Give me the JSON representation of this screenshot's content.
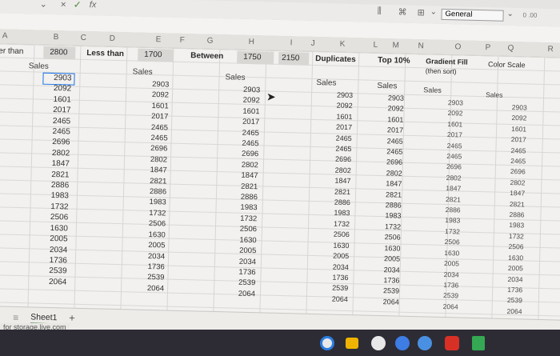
{
  "formula_bar": {
    "fx": "fx",
    "cancel": "×",
    "accept": "✓"
  },
  "toolbar": {
    "format_select": "General",
    "decimals_label": "0 .00"
  },
  "column_headers": [
    "A",
    "B",
    "C",
    "D",
    "E",
    "F",
    "G",
    "H",
    "I",
    "J",
    "K",
    "L",
    "M",
    "N",
    "O",
    "P",
    "Q",
    "R"
  ],
  "row1": {
    "greater_than_label": "er than",
    "greater_than_value": "2800",
    "less_than_label": "Less than",
    "less_than_value": "1700",
    "between_label": "Between",
    "between_low": "1750",
    "between_high": "2150",
    "duplicates_label": "Duplicates",
    "top10_label": "Top 10%",
    "gradient_label_1": "Gradient Fill",
    "gradient_label_2": "(then sort)",
    "color_scale_label": "Color Scale"
  },
  "sales_header": "Sales",
  "sales_values": [
    "2903",
    "2092",
    "1601",
    "2017",
    "2465",
    "2465",
    "2696",
    "2802",
    "1847",
    "2821",
    "2886",
    "1983",
    "1732",
    "2506",
    "1630",
    "2005",
    "2034",
    "1736",
    "2539",
    "2064"
  ],
  "sheet_tab": {
    "name": "Sheet1",
    "add": "+"
  },
  "status_url": "for storage.live.com"
}
